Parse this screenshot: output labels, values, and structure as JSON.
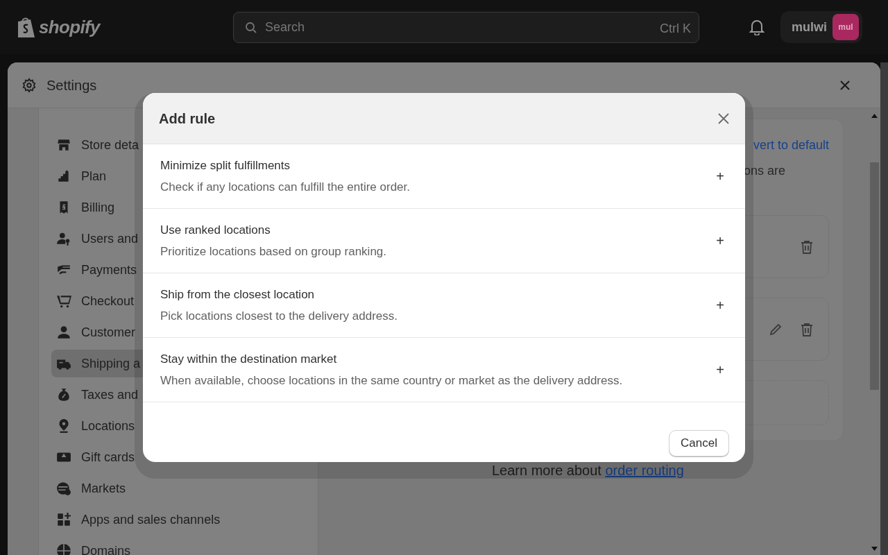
{
  "top_bar": {
    "logo": "shopify",
    "search": {
      "placeholder": "Search",
      "shortcut": "Ctrl K"
    },
    "user": {
      "name": "mulwi",
      "initials": "mul"
    }
  },
  "settings": {
    "title": "Settings",
    "sidebar": [
      {
        "label": "Store deta",
        "selected": false
      },
      {
        "label": "Plan",
        "selected": false
      },
      {
        "label": "Billing",
        "selected": false
      },
      {
        "label": "Users and",
        "selected": false
      },
      {
        "label": "Payments",
        "selected": false
      },
      {
        "label": "Checkout",
        "selected": false
      },
      {
        "label": "Customer",
        "selected": false
      },
      {
        "label": "Shipping a",
        "selected": true
      },
      {
        "label": "Taxes and",
        "selected": false
      },
      {
        "label": "Locations",
        "selected": false
      },
      {
        "label": "Gift cards",
        "selected": false
      },
      {
        "label": "Markets",
        "selected": false
      },
      {
        "label": "Apps and sales channels",
        "selected": false
      },
      {
        "label": "Domains",
        "selected": false
      }
    ],
    "content": {
      "link": "vert to default",
      "text": "ons are",
      "rule_cards": [
        {
          "editable": false
        },
        {
          "editable": true
        }
      ],
      "footer_text": "Learn more about",
      "footer_link": "order routing"
    }
  },
  "modal": {
    "title": "Add rule",
    "options": [
      {
        "title": "Minimize split fulfillments",
        "description": "Check if any locations can fulfill the entire order.",
        "action": "+"
      },
      {
        "title": "Use ranked locations",
        "description": "Prioritize locations based on group ranking.",
        "action": "+"
      },
      {
        "title": "Ship from the closest location",
        "description": "Pick locations closest to the delivery address.",
        "action": "+"
      },
      {
        "title": "Stay within the destination market",
        "description": "When available, choose locations in the same country or market as the delivery address.",
        "action": "+"
      }
    ],
    "buttons": [
      "Cancel"
    ]
  }
}
